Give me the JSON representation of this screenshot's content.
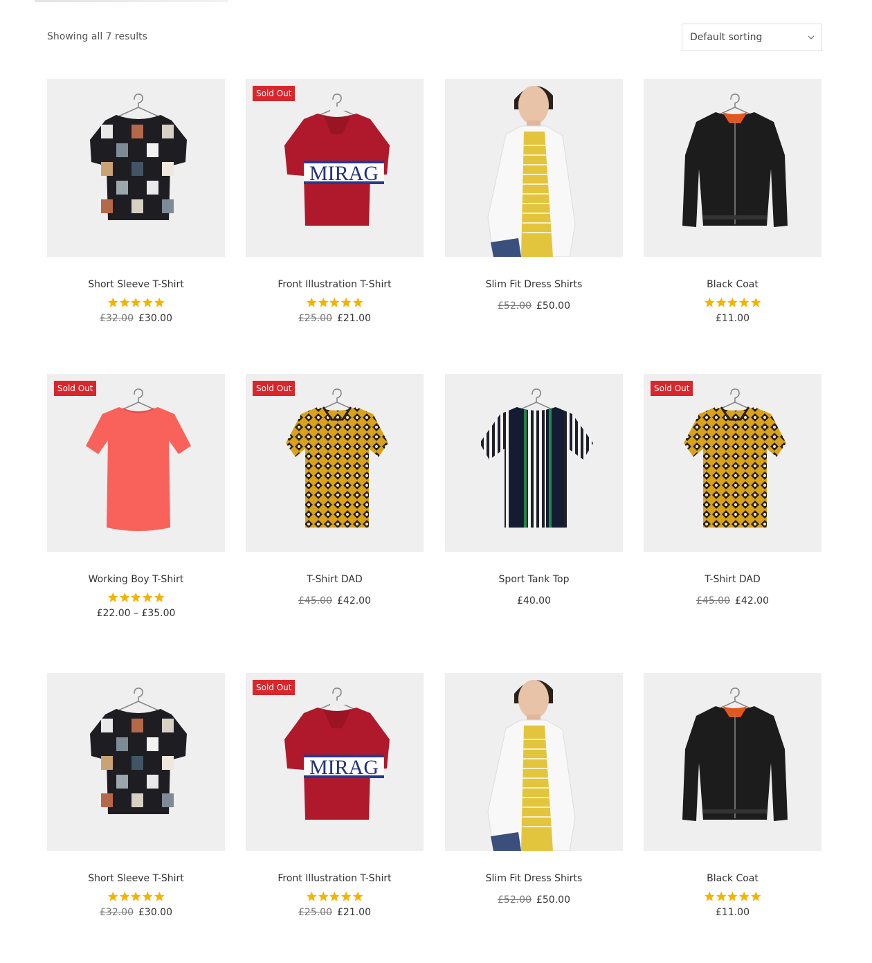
{
  "toolbar": {
    "result_count": "Showing all 7 results",
    "sort_value": "Default sorting"
  },
  "colors": {
    "badge": "#d9262c",
    "star": "#f5b301",
    "image_bg": "#efefef"
  },
  "products": [
    {
      "title": "Short Sleeve T-Shirt",
      "rating_stars": 5,
      "price_old": "£32.00",
      "price": "£30.00",
      "badge": "",
      "image": "tshirt-print-icon"
    },
    {
      "title": "Front Illustration T-Shirt",
      "rating_stars": 5,
      "price_old": "£25.00",
      "price": "£21.00",
      "badge": "Sold Out",
      "image": "polo-mirag-icon",
      "image_text": "MIRAG"
    },
    {
      "title": "Slim Fit Dress Shirts",
      "rating_stars": 0,
      "price_old": "£52.00",
      "price": "£50.00",
      "badge": "",
      "image": "model-shirt-icon"
    },
    {
      "title": "Black Coat",
      "rating_stars": 5,
      "price_old": "",
      "price": "£11.00",
      "badge": "",
      "image": "bomber-jacket-icon"
    },
    {
      "title": "Working Boy T-Shirt",
      "rating_stars": 5,
      "price_old": "",
      "price": "£22.00 – £35.00",
      "badge": "Sold Out",
      "image": "coral-tee-icon"
    },
    {
      "title": "T-Shirt DAD",
      "rating_stars": 0,
      "price_old": "£45.00",
      "price": "£42.00",
      "badge": "Sold Out",
      "image": "pattern-shirt-icon"
    },
    {
      "title": "Sport Tank Top",
      "rating_stars": 0,
      "price_old": "",
      "price": "£40.00",
      "badge": "",
      "image": "striped-shirt-icon"
    },
    {
      "title": "T-Shirt DAD",
      "rating_stars": 0,
      "price_old": "£45.00",
      "price": "£42.00",
      "badge": "Sold Out",
      "image": "pattern-shirt-icon"
    },
    {
      "title": "Short Sleeve T-Shirt",
      "rating_stars": 5,
      "price_old": "£32.00",
      "price": "£30.00",
      "badge": "",
      "image": "tshirt-print-icon"
    },
    {
      "title": "Front Illustration T-Shirt",
      "rating_stars": 5,
      "price_old": "£25.00",
      "price": "£21.00",
      "badge": "Sold Out",
      "image": "polo-mirag-icon",
      "image_text": "MIRAG"
    },
    {
      "title": "Slim Fit Dress Shirts",
      "rating_stars": 0,
      "price_old": "£52.00",
      "price": "£50.00",
      "badge": "",
      "image": "model-shirt-icon"
    },
    {
      "title": "Black Coat",
      "rating_stars": 5,
      "price_old": "",
      "price": "£11.00",
      "badge": "",
      "image": "bomber-jacket-icon"
    }
  ]
}
